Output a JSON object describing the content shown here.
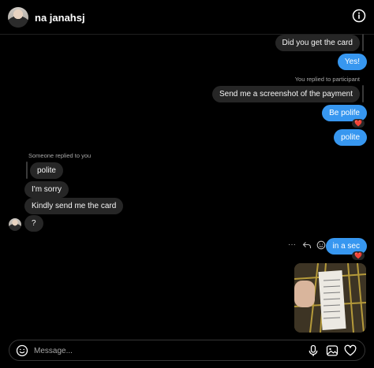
{
  "header": {
    "title": "na janahsj",
    "info_icon": "info-icon"
  },
  "messages": {
    "m1": "Did you get the card",
    "m2": "Yes!",
    "reply_meta_me": "You replied to participant",
    "m3": "Send me a screenshot of the payment",
    "m4": "Be polife",
    "m4_reaction": "❤️",
    "m5": "polite",
    "reply_meta_them": "Someone replied to you",
    "quoted": "polite",
    "m6": "I'm sorry",
    "m7": "Kindly send me the card",
    "m8": "?",
    "m9": "in a sec",
    "m9_reaction": "❤️",
    "more_icon": "···"
  },
  "colors": {
    "accent": "#3797f0",
    "bubble_them": "#262626",
    "background": "#000000",
    "heart": "#ed4956"
  },
  "composer": {
    "placeholder": "Message..."
  },
  "icons": [
    "info-icon",
    "emoji-icon",
    "microphone-icon",
    "image-icon",
    "heart-icon",
    "reply-icon",
    "react-icon",
    "more-icon"
  ]
}
